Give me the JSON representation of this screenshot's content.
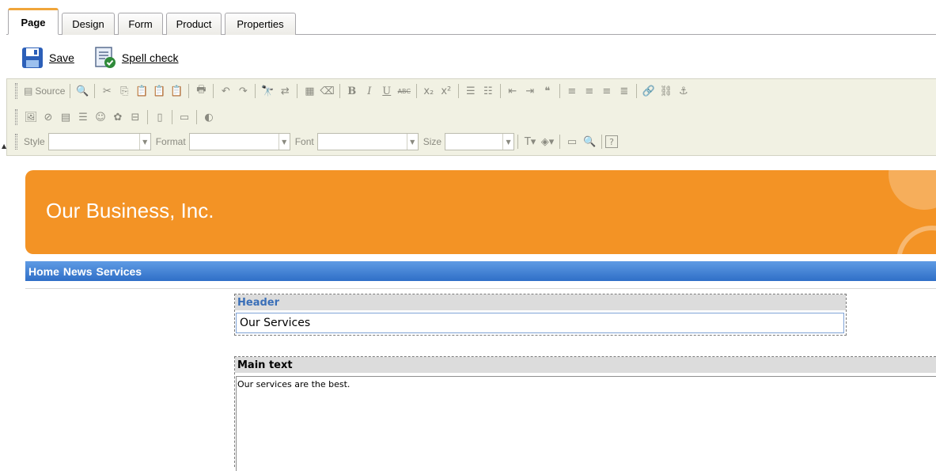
{
  "tabs": [
    {
      "label": "Page",
      "active": true
    },
    {
      "label": "Design"
    },
    {
      "label": "Form"
    },
    {
      "label": "Product"
    },
    {
      "label": "Properties"
    }
  ],
  "actions": {
    "save_label": "Save",
    "spell_label": "Spell check"
  },
  "toolbar": {
    "source_label": "Source",
    "style_label": "Style",
    "format_label": "Format",
    "font_label": "Font",
    "size_label": "Size",
    "bold": "B",
    "italic": "I",
    "underline": "U",
    "strike": "ABC",
    "help": "?"
  },
  "site": {
    "title": "Our Business, Inc.",
    "nav": [
      "Home",
      "News",
      "Services"
    ]
  },
  "regions": {
    "header_label": "Header",
    "header_value": "Our Services",
    "main_label": "Main text",
    "main_value": "Our services are the best."
  },
  "colors": {
    "banner": "#f39325",
    "nav": "#2f6fc7",
    "tab_accent": "#f0a53a"
  }
}
